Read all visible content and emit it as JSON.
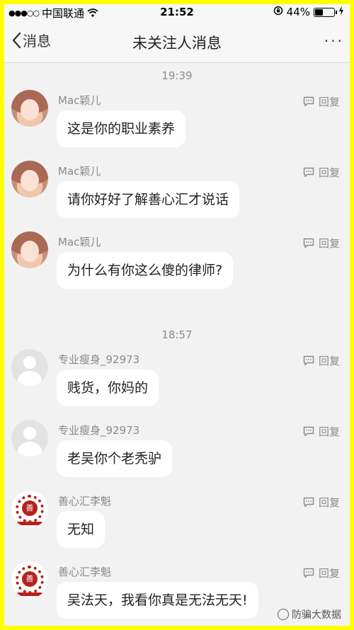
{
  "status_bar": {
    "signal": "●●●○○",
    "carrier": "中国联通",
    "time": "21:52",
    "battery": "44%",
    "battery_level": 0.44
  },
  "nav": {
    "back_label": "消息",
    "title": "未关注人消息",
    "more": "···"
  },
  "groups": [
    {
      "time": "19:39",
      "messages": [
        {
          "sender": "Mac颖儿",
          "text": "这是你的职业素养",
          "reply": "回复",
          "avatar": "girl-avatar"
        },
        {
          "sender": "Mac颖儿",
          "text": "请你好好了解善心汇才说话",
          "reply": "回复",
          "avatar": "girl-avatar"
        },
        {
          "sender": "Mac颖儿",
          "text": "为什么有你这么傻的律师?",
          "reply": "回复",
          "avatar": "girl-avatar"
        }
      ]
    },
    {
      "time": "18:57",
      "messages": [
        {
          "sender": "专业瘦身_92973",
          "text": "贱货，你妈的",
          "reply": "回复",
          "avatar": "default-avatar"
        },
        {
          "sender": "专业瘦身_92973",
          "text": "老吴你个老秃驴",
          "reply": "回复",
          "avatar": "default-avatar"
        },
        {
          "sender": "善心汇李魁",
          "text": "无知",
          "reply": "回复",
          "avatar": "seal-avatar"
        },
        {
          "sender": "善心汇李魁",
          "text": "吴法天，我看你真是无法无天!",
          "reply": "回复",
          "avatar": "seal-avatar"
        }
      ]
    }
  ],
  "watermark": "防骗大数据",
  "colors": {
    "border": "#ffff00",
    "background": "#f2f2f2",
    "bubble": "#ffffff",
    "meta_text": "#8a8a8a"
  }
}
